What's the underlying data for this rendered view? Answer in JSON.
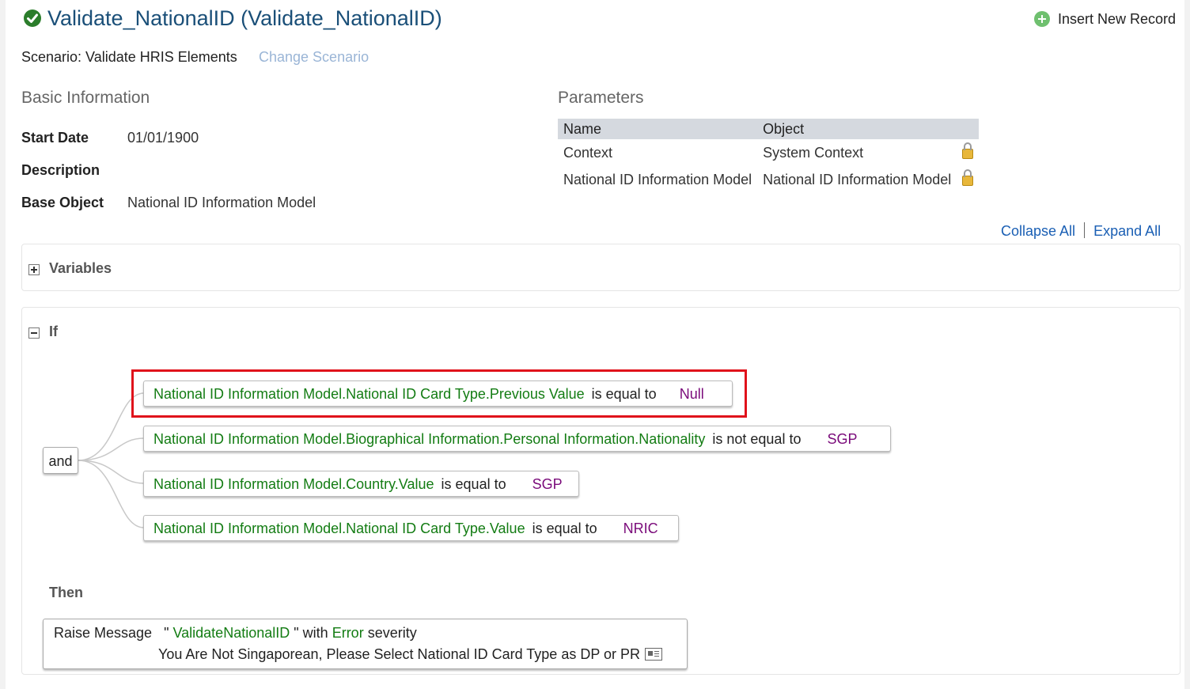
{
  "header": {
    "title": "Validate_NationalID (Validate_NationalID)",
    "insert_label": "Insert New Record"
  },
  "scenario": {
    "text": "Scenario: Validate HRIS Elements",
    "change_label": "Change Scenario"
  },
  "basic": {
    "heading": "Basic Information",
    "fields": [
      {
        "label": "Start Date",
        "value": "01/01/1900"
      },
      {
        "label": "Description",
        "value": ""
      },
      {
        "label": "Base Object",
        "value": "National ID Information Model"
      }
    ]
  },
  "parameters": {
    "heading": "Parameters",
    "columns": [
      "Name",
      "Object"
    ],
    "rows": [
      {
        "name": "Context",
        "object": "System Context"
      },
      {
        "name": "National ID Information Model",
        "object": "National ID Information Model"
      }
    ]
  },
  "links": {
    "collapse_all": "Collapse All",
    "expand_all": "Expand All"
  },
  "variables": {
    "title": "Variables"
  },
  "if_section": {
    "title": "If",
    "operator": "and",
    "conditions": [
      {
        "field": "National ID Information Model.National ID Card Type.Previous Value",
        "op": "is equal to",
        "value": "Null"
      },
      {
        "field": "National ID Information Model.Biographical Information.Personal Information.Nationality",
        "op": "is not equal to",
        "value": "SGP"
      },
      {
        "field": "National ID Information Model.Country.Value",
        "op": "is equal to",
        "value": "SGP"
      },
      {
        "field": "National ID Information Model.National ID Card Type.Value",
        "op": "is equal to",
        "value": "NRIC"
      }
    ]
  },
  "then_section": {
    "title": "Then",
    "action_label": "Raise Message",
    "quote_open": "\"",
    "message_id": "ValidateNationalID",
    "with_text": "\" with",
    "severity": "Error",
    "severity_text": "severity",
    "message_text": "You Are Not Singaporean, Please Select National ID Card Type as DP or PR"
  },
  "colors": {
    "field_green": "#137c13",
    "value_purple": "#7a0a7a",
    "link_blue": "#1a5fb4",
    "highlight_red": "#e0121b",
    "title_blue": "#1a4f78"
  }
}
